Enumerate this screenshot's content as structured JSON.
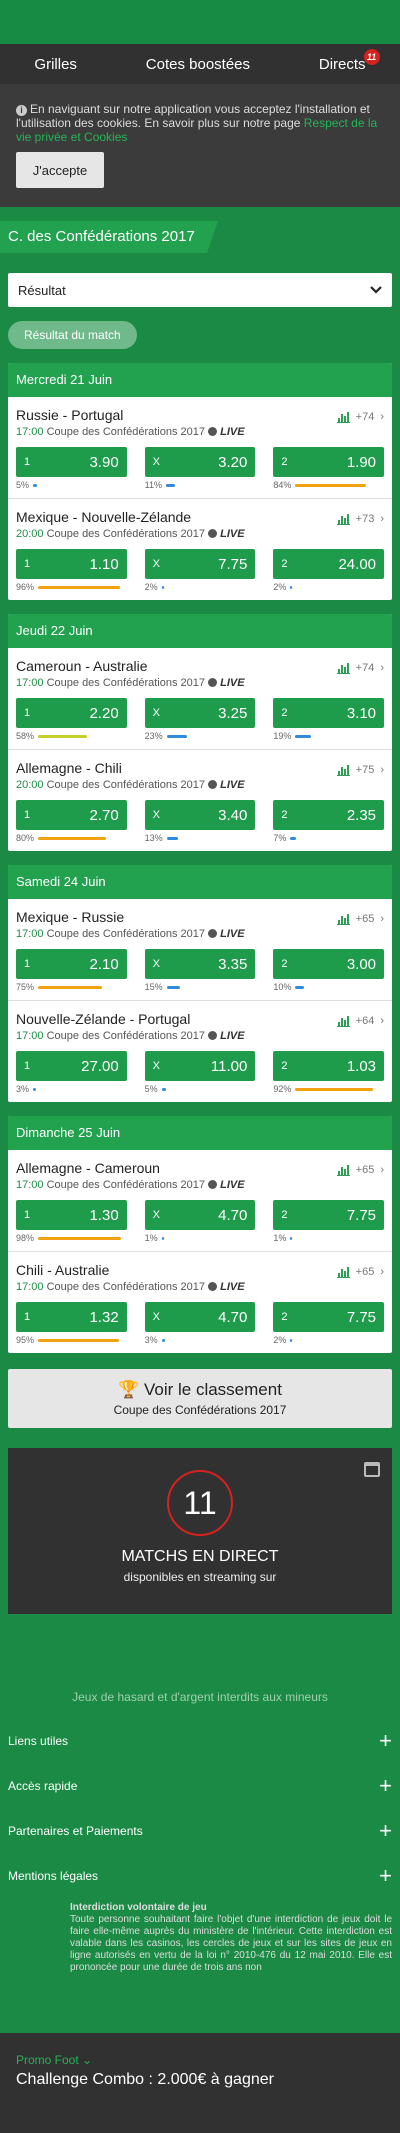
{
  "nav": {
    "tabs": [
      "Grilles",
      "Cotes boostées",
      "Directs"
    ],
    "directs_badge": "11"
  },
  "cookie": {
    "text": "En naviguant sur notre application vous acceptez l'installation et l'utilisation des cookies. En savoir plus sur notre page",
    "link": "Respect de la vie privée et Cookies",
    "accept": "J'accepte"
  },
  "competition": "C. des Confédérations 2017",
  "market_select": "Résultat",
  "chip": "Résultat du match",
  "days": [
    {
      "label": "Mercredi 21 Juin",
      "matches": [
        {
          "teams": "Russie - Portugal",
          "time": "17:00",
          "comp": "Coupe des Confédérations 2017",
          "live": "LIVE",
          "more": "+74",
          "odds": [
            {
              "l": "1",
              "v": "3.90",
              "p": "5%",
              "c": "#2f8be0"
            },
            {
              "l": "X",
              "v": "3.20",
              "p": "11%",
              "c": "#2f8be0"
            },
            {
              "l": "2",
              "v": "1.90",
              "p": "84%",
              "c": "#f2a20f"
            }
          ]
        },
        {
          "teams": "Mexique - Nouvelle-Zélande",
          "time": "20:00",
          "comp": "Coupe des Confédérations 2017",
          "live": "LIVE",
          "more": "+73",
          "odds": [
            {
              "l": "1",
              "v": "1.10",
              "p": "96%",
              "c": "#f2a20f"
            },
            {
              "l": "X",
              "v": "7.75",
              "p": "2%",
              "c": "#2f8be0"
            },
            {
              "l": "2",
              "v": "24.00",
              "p": "2%",
              "c": "#2f8be0"
            }
          ]
        }
      ]
    },
    {
      "label": "Jeudi 22 Juin",
      "matches": [
        {
          "teams": "Cameroun - Australie",
          "time": "17:00",
          "comp": "Coupe des Confédérations 2017",
          "live": "LIVE",
          "more": "+74",
          "odds": [
            {
              "l": "1",
              "v": "2.20",
              "p": "58%",
              "c": "#c5cf2b"
            },
            {
              "l": "X",
              "v": "3.25",
              "p": "23%",
              "c": "#2f8be0"
            },
            {
              "l": "2",
              "v": "3.10",
              "p": "19%",
              "c": "#2f8be0"
            }
          ]
        },
        {
          "teams": "Allemagne - Chili",
          "time": "20:00",
          "comp": "Coupe des Confédérations 2017",
          "live": "LIVE",
          "more": "+75",
          "odds": [
            {
              "l": "1",
              "v": "2.70",
              "p": "80%",
              "c": "#f2a20f"
            },
            {
              "l": "X",
              "v": "3.40",
              "p": "13%",
              "c": "#2f8be0"
            },
            {
              "l": "2",
              "v": "2.35",
              "p": "7%",
              "c": "#2f8be0"
            }
          ]
        }
      ]
    },
    {
      "label": "Samedi 24 Juin",
      "matches": [
        {
          "teams": "Mexique - Russie",
          "time": "17:00",
          "comp": "Coupe des Confédérations 2017",
          "live": "LIVE",
          "more": "+65",
          "odds": [
            {
              "l": "1",
              "v": "2.10",
              "p": "75%",
              "c": "#f2a20f"
            },
            {
              "l": "X",
              "v": "3.35",
              "p": "15%",
              "c": "#2f8be0"
            },
            {
              "l": "2",
              "v": "3.00",
              "p": "10%",
              "c": "#2f8be0"
            }
          ]
        },
        {
          "teams": "Nouvelle-Zélande - Portugal",
          "time": "17:00",
          "comp": "Coupe des Confédérations 2017",
          "live": "LIVE",
          "more": "+64",
          "odds": [
            {
              "l": "1",
              "v": "27.00",
              "p": "3%",
              "c": "#2f8be0"
            },
            {
              "l": "X",
              "v": "11.00",
              "p": "5%",
              "c": "#2f8be0"
            },
            {
              "l": "2",
              "v": "1.03",
              "p": "92%",
              "c": "#f2a20f"
            }
          ]
        }
      ]
    },
    {
      "label": "Dimanche 25 Juin",
      "matches": [
        {
          "teams": "Allemagne - Cameroun",
          "time": "17:00",
          "comp": "Coupe des Confédérations 2017",
          "live": "LIVE",
          "more": "+65",
          "odds": [
            {
              "l": "1",
              "v": "1.30",
              "p": "98%",
              "c": "#f2a20f"
            },
            {
              "l": "X",
              "v": "4.70",
              "p": "1%",
              "c": "#2f8be0"
            },
            {
              "l": "2",
              "v": "7.75",
              "p": "1%",
              "c": "#2f8be0"
            }
          ]
        },
        {
          "teams": "Chili - Australie",
          "time": "17:00",
          "comp": "Coupe des Confédérations 2017",
          "live": "LIVE",
          "more": "+65",
          "odds": [
            {
              "l": "1",
              "v": "1.32",
              "p": "95%",
              "c": "#f2a20f"
            },
            {
              "l": "X",
              "v": "4.70",
              "p": "3%",
              "c": "#2f8be0"
            },
            {
              "l": "2",
              "v": "7.75",
              "p": "2%",
              "c": "#2f8be0"
            }
          ]
        }
      ]
    }
  ],
  "classement": {
    "title": "Voir le classement",
    "subtitle": "Coupe des Confédérations 2017"
  },
  "direct": {
    "count": "11",
    "title": "MATCHS EN DIRECT",
    "subtitle": "disponibles en streaming sur"
  },
  "jeux": "Jeux de hasard et d'argent interdits aux mineurs",
  "accordion": [
    "Liens utiles",
    "Accès rapide",
    "Partenaires et Paiements",
    "Mentions légales"
  ],
  "legal": {
    "title": "Interdiction volontaire de jeu",
    "text": "Toute personne souhaitant faire l'objet d'une interdiction de jeux doit le faire elle-même auprès du ministère de l'intérieur. Cette interdiction est valable dans les casinos, les cercles de jeux et sur les sites de jeux en ligne autorisés en vertu de la loi n° 2010-476 du 12 mai 2010. Elle est prononcée pour une durée de trois ans non"
  },
  "promo": {
    "label": "Promo Foot",
    "title": "Challenge Combo : 2.000€ à gagner"
  }
}
